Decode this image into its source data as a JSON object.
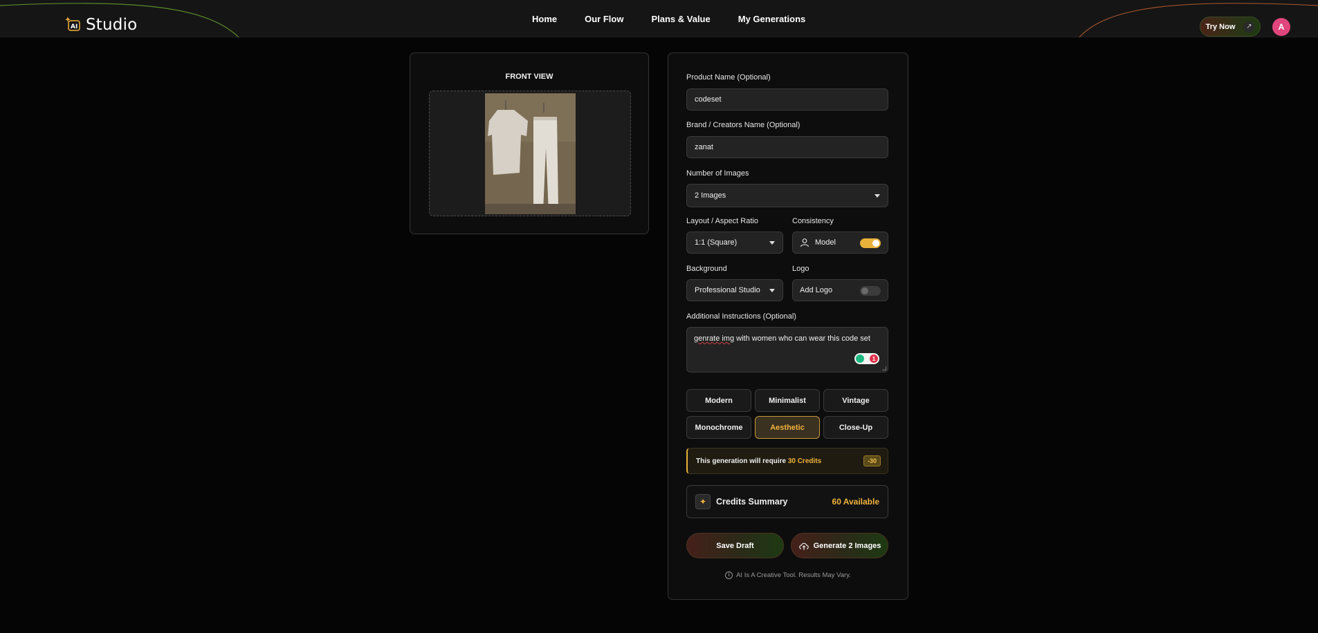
{
  "header": {
    "logo_badge": "AI",
    "logo_text": "Studio",
    "nav": [
      {
        "label": "Home"
      },
      {
        "label": "Our Flow"
      },
      {
        "label": "Plans & Value"
      },
      {
        "label": "My Generations"
      }
    ],
    "try_now_label": "Try Now",
    "avatar_initial": "A"
  },
  "upload": {
    "title": "FRONT VIEW"
  },
  "form": {
    "product_name": {
      "label": "Product Name (Optional)",
      "value": "codeset"
    },
    "brand_name": {
      "label": "Brand / Creators Name (Optional)",
      "value": "zanat"
    },
    "num_images": {
      "label": "Number of Images",
      "value": "2 Images"
    },
    "layout": {
      "label": "Layout / Aspect Ratio",
      "value": "1:1 (Square)"
    },
    "consistency": {
      "label": "Consistency",
      "option": "Model",
      "enabled": true
    },
    "background": {
      "label": "Background",
      "value": "Professional Studio"
    },
    "logo": {
      "label": "Logo",
      "option": "Add Logo",
      "enabled": false
    },
    "instructions": {
      "label": "Additional Instructions (Optional)",
      "misspelled": "genrate img",
      "rest": " with women who can wear this code set",
      "grammar_count": "1"
    },
    "styles": [
      {
        "label": "Modern",
        "active": false
      },
      {
        "label": "Minimalist",
        "active": false
      },
      {
        "label": "Vintage",
        "active": false
      },
      {
        "label": "Monochrome",
        "active": false
      },
      {
        "label": "Aesthetic",
        "active": true
      },
      {
        "label": "Close-Up",
        "active": false
      }
    ],
    "credit_note": {
      "prefix": "This generation will require ",
      "amount": "30 Credits",
      "chip": "-30"
    },
    "credits_summary": {
      "title": "Credits Summary",
      "available": "60 Available"
    },
    "save_draft_label": "Save Draft",
    "generate_label": "Generate 2 Images",
    "disclaimer": "AI Is A Creative Tool. Results May Vary."
  },
  "colors": {
    "accent": "#f2b33d",
    "background": "#050505",
    "panel": "#0d0d0d",
    "avatar": "#e0457b"
  }
}
